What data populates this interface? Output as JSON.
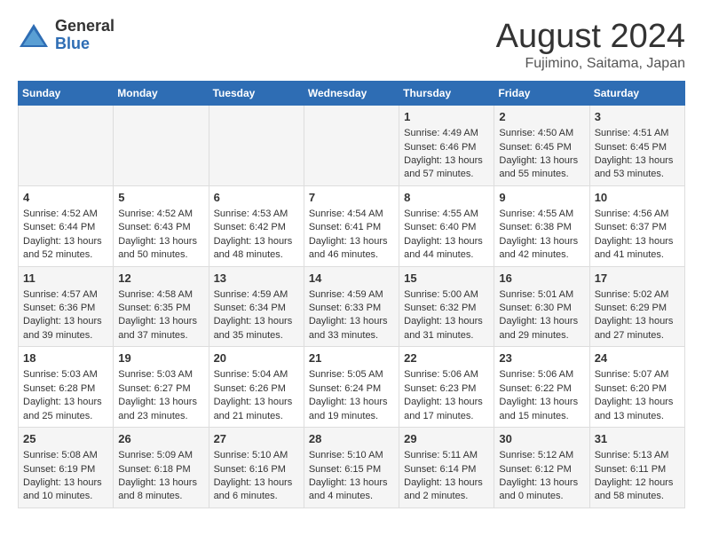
{
  "header": {
    "logo_line1": "General",
    "logo_line2": "Blue",
    "month_title": "August 2024",
    "subtitle": "Fujimino, Saitama, Japan"
  },
  "days_of_week": [
    "Sunday",
    "Monday",
    "Tuesday",
    "Wednesday",
    "Thursday",
    "Friday",
    "Saturday"
  ],
  "weeks": [
    [
      {
        "day": "",
        "info": ""
      },
      {
        "day": "",
        "info": ""
      },
      {
        "day": "",
        "info": ""
      },
      {
        "day": "",
        "info": ""
      },
      {
        "day": "1",
        "info": "Sunrise: 4:49 AM\nSunset: 6:46 PM\nDaylight: 13 hours\nand 57 minutes."
      },
      {
        "day": "2",
        "info": "Sunrise: 4:50 AM\nSunset: 6:45 PM\nDaylight: 13 hours\nand 55 minutes."
      },
      {
        "day": "3",
        "info": "Sunrise: 4:51 AM\nSunset: 6:45 PM\nDaylight: 13 hours\nand 53 minutes."
      }
    ],
    [
      {
        "day": "4",
        "info": "Sunrise: 4:52 AM\nSunset: 6:44 PM\nDaylight: 13 hours\nand 52 minutes."
      },
      {
        "day": "5",
        "info": "Sunrise: 4:52 AM\nSunset: 6:43 PM\nDaylight: 13 hours\nand 50 minutes."
      },
      {
        "day": "6",
        "info": "Sunrise: 4:53 AM\nSunset: 6:42 PM\nDaylight: 13 hours\nand 48 minutes."
      },
      {
        "day": "7",
        "info": "Sunrise: 4:54 AM\nSunset: 6:41 PM\nDaylight: 13 hours\nand 46 minutes."
      },
      {
        "day": "8",
        "info": "Sunrise: 4:55 AM\nSunset: 6:40 PM\nDaylight: 13 hours\nand 44 minutes."
      },
      {
        "day": "9",
        "info": "Sunrise: 4:55 AM\nSunset: 6:38 PM\nDaylight: 13 hours\nand 42 minutes."
      },
      {
        "day": "10",
        "info": "Sunrise: 4:56 AM\nSunset: 6:37 PM\nDaylight: 13 hours\nand 41 minutes."
      }
    ],
    [
      {
        "day": "11",
        "info": "Sunrise: 4:57 AM\nSunset: 6:36 PM\nDaylight: 13 hours\nand 39 minutes."
      },
      {
        "day": "12",
        "info": "Sunrise: 4:58 AM\nSunset: 6:35 PM\nDaylight: 13 hours\nand 37 minutes."
      },
      {
        "day": "13",
        "info": "Sunrise: 4:59 AM\nSunset: 6:34 PM\nDaylight: 13 hours\nand 35 minutes."
      },
      {
        "day": "14",
        "info": "Sunrise: 4:59 AM\nSunset: 6:33 PM\nDaylight: 13 hours\nand 33 minutes."
      },
      {
        "day": "15",
        "info": "Sunrise: 5:00 AM\nSunset: 6:32 PM\nDaylight: 13 hours\nand 31 minutes."
      },
      {
        "day": "16",
        "info": "Sunrise: 5:01 AM\nSunset: 6:30 PM\nDaylight: 13 hours\nand 29 minutes."
      },
      {
        "day": "17",
        "info": "Sunrise: 5:02 AM\nSunset: 6:29 PM\nDaylight: 13 hours\nand 27 minutes."
      }
    ],
    [
      {
        "day": "18",
        "info": "Sunrise: 5:03 AM\nSunset: 6:28 PM\nDaylight: 13 hours\nand 25 minutes."
      },
      {
        "day": "19",
        "info": "Sunrise: 5:03 AM\nSunset: 6:27 PM\nDaylight: 13 hours\nand 23 minutes."
      },
      {
        "day": "20",
        "info": "Sunrise: 5:04 AM\nSunset: 6:26 PM\nDaylight: 13 hours\nand 21 minutes."
      },
      {
        "day": "21",
        "info": "Sunrise: 5:05 AM\nSunset: 6:24 PM\nDaylight: 13 hours\nand 19 minutes."
      },
      {
        "day": "22",
        "info": "Sunrise: 5:06 AM\nSunset: 6:23 PM\nDaylight: 13 hours\nand 17 minutes."
      },
      {
        "day": "23",
        "info": "Sunrise: 5:06 AM\nSunset: 6:22 PM\nDaylight: 13 hours\nand 15 minutes."
      },
      {
        "day": "24",
        "info": "Sunrise: 5:07 AM\nSunset: 6:20 PM\nDaylight: 13 hours\nand 13 minutes."
      }
    ],
    [
      {
        "day": "25",
        "info": "Sunrise: 5:08 AM\nSunset: 6:19 PM\nDaylight: 13 hours\nand 10 minutes."
      },
      {
        "day": "26",
        "info": "Sunrise: 5:09 AM\nSunset: 6:18 PM\nDaylight: 13 hours\nand 8 minutes."
      },
      {
        "day": "27",
        "info": "Sunrise: 5:10 AM\nSunset: 6:16 PM\nDaylight: 13 hours\nand 6 minutes."
      },
      {
        "day": "28",
        "info": "Sunrise: 5:10 AM\nSunset: 6:15 PM\nDaylight: 13 hours\nand 4 minutes."
      },
      {
        "day": "29",
        "info": "Sunrise: 5:11 AM\nSunset: 6:14 PM\nDaylight: 13 hours\nand 2 minutes."
      },
      {
        "day": "30",
        "info": "Sunrise: 5:12 AM\nSunset: 6:12 PM\nDaylight: 13 hours\nand 0 minutes."
      },
      {
        "day": "31",
        "info": "Sunrise: 5:13 AM\nSunset: 6:11 PM\nDaylight: 12 hours\nand 58 minutes."
      }
    ]
  ]
}
